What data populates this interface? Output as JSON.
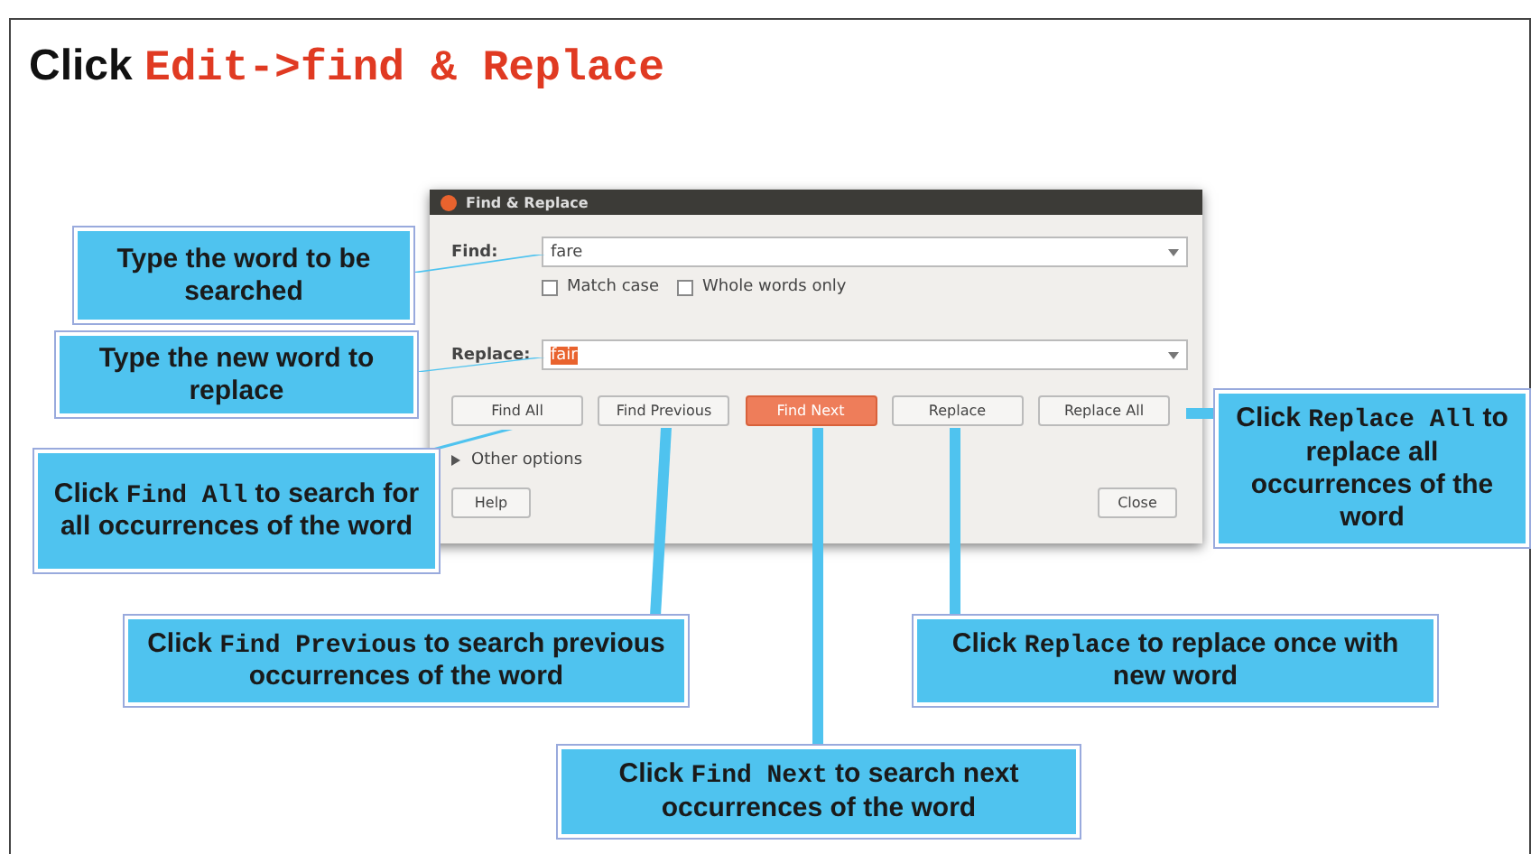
{
  "heading": {
    "text": "Click ",
    "code": "Edit->find & Replace"
  },
  "dialog": {
    "title": "Find & Replace",
    "find": {
      "label": "Find:",
      "value": "fare"
    },
    "options": [
      {
        "label": "Match case",
        "checked": false
      },
      {
        "label": "Whole words only",
        "checked": false
      }
    ],
    "replace": {
      "label": "Replace:",
      "value": "fair",
      "value_selected": true
    },
    "buttons": [
      {
        "label": "Find All",
        "default": false
      },
      {
        "label": "Find Previous",
        "default": false
      },
      {
        "label": "Find Next",
        "default": true
      },
      {
        "label": "Replace",
        "default": false
      },
      {
        "label": "Replace All",
        "default": false
      }
    ],
    "other_options": {
      "label": "Other options",
      "expanded": false
    },
    "help": "Help",
    "close": "Close"
  },
  "callouts": [
    {
      "before": "Type the word to be searched"
    },
    {
      "before": "Type the new word to replace"
    },
    {
      "before": "Click ",
      "code": "Find All",
      "after": " to search for all occurrences of the word"
    },
    {
      "before": "Click ",
      "code": "Replace All",
      "after": " to replace all occurrences of the word"
    },
    {
      "before": "Click ",
      "code": "Find Previous",
      "after": " to search previous occurrences of the word"
    },
    {
      "before": "Click ",
      "code": "Replace",
      "after": " to replace once with new word"
    },
    {
      "before": "Click ",
      "code": "Find Next",
      "after": " to search next occurrences of the word"
    }
  ]
}
